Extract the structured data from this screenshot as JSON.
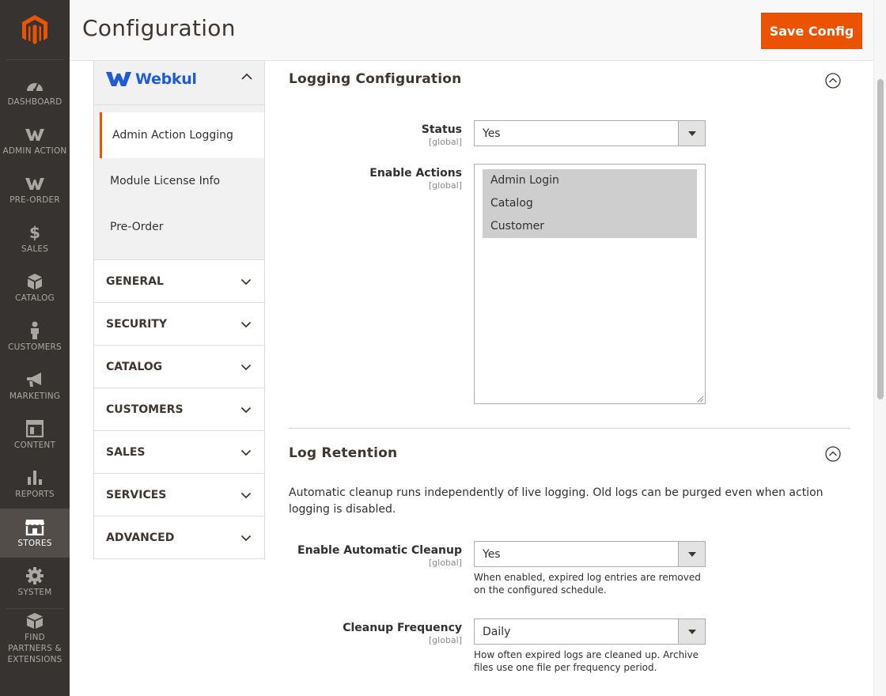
{
  "nav": {
    "items": [
      {
        "label": "DASHBOARD",
        "icon": "dashboard-icon"
      },
      {
        "label": "ADMIN ACTION",
        "icon": "webkul-w-icon"
      },
      {
        "label": "PRE-ORDER",
        "icon": "webkul-w-icon"
      },
      {
        "label": "SALES",
        "icon": "dollar-icon"
      },
      {
        "label": "CATALOG",
        "icon": "box-icon"
      },
      {
        "label": "CUSTOMERS",
        "icon": "person-icon"
      },
      {
        "label": "MARKETING",
        "icon": "megaphone-icon"
      },
      {
        "label": "CONTENT",
        "icon": "layout-icon"
      },
      {
        "label": "REPORTS",
        "icon": "bar-chart-icon"
      },
      {
        "label": "STORES",
        "icon": "storefront-icon",
        "active": true
      },
      {
        "label": "SYSTEM",
        "icon": "gear-icon"
      },
      {
        "label": "FIND PARTNERS & EXTENSIONS",
        "icon": "extensions-box-icon"
      }
    ]
  },
  "header": {
    "title": "Configuration",
    "save_label": "Save Config",
    "accent": "#eb5202"
  },
  "sidebar": {
    "group_name": "Webkul",
    "group_items": [
      {
        "label": "Admin Action Logging",
        "active": true
      },
      {
        "label": "Module License Info"
      },
      {
        "label": "Pre-Order"
      }
    ],
    "sections": [
      "GENERAL",
      "SECURITY",
      "CATALOG",
      "CUSTOMERS",
      "SALES",
      "SERVICES",
      "ADVANCED"
    ]
  },
  "logging": {
    "title": "Logging Configuration",
    "status": {
      "label": "Status",
      "scope": "[global]",
      "value": "Yes"
    },
    "actions": {
      "label": "Enable Actions",
      "scope": "[global]",
      "options": [
        "Admin Login",
        "Catalog",
        "Customer"
      ]
    }
  },
  "retention": {
    "title": "Log Retention",
    "intro": "Automatic cleanup runs independently of live logging. Old logs can be purged even when action logging is disabled.",
    "cleanup": {
      "label": "Enable Automatic Cleanup",
      "scope": "[global]",
      "value": "Yes",
      "note": "When enabled, expired log entries are removed on the configured schedule."
    },
    "frequency": {
      "label": "Cleanup Frequency",
      "scope": "[global]",
      "value": "Daily",
      "note": "How often expired logs are cleaned up. Archive files use one file per frequency period."
    }
  }
}
